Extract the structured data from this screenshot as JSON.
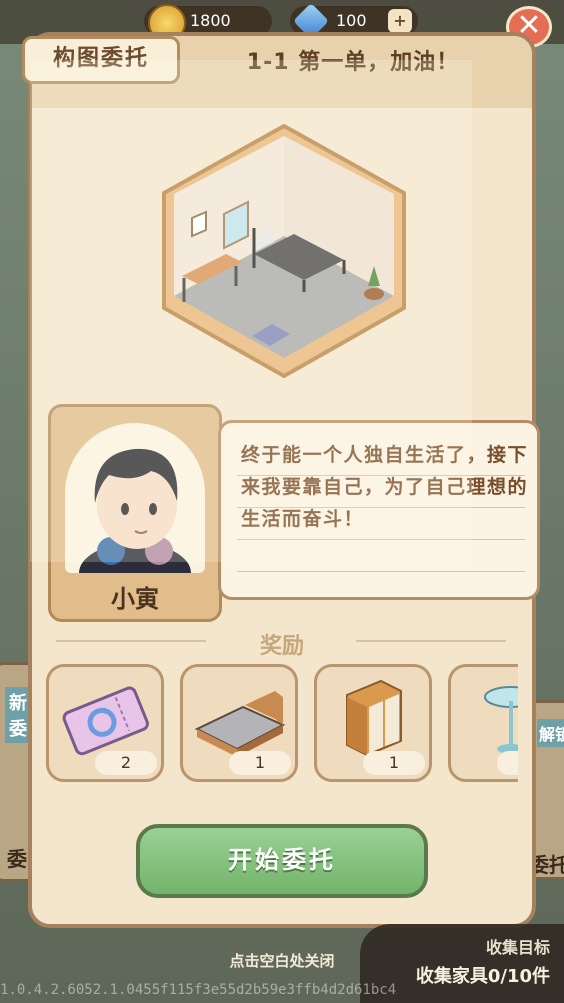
{
  "top_bar": {
    "coins": "1800",
    "gems": "100",
    "coin_icon": "coin-icon",
    "gem_icon": "gem-icon",
    "add_icon": "plus-icon",
    "close_icon": "close-icon"
  },
  "dialog": {
    "tag_label": "构图委托",
    "stage_title": "1-1 第一单，加油！",
    "character_name": "小寅",
    "dialogue": "终于能一个人独自生活了，接下来我要靠自己，为了自己理想的生活而奋斗！",
    "rewards_label": "奖励",
    "rewards": [
      {
        "icon": "ticket-icon",
        "count": "2"
      },
      {
        "icon": "bed-icon",
        "count": "1"
      },
      {
        "icon": "cabinet-icon",
        "count": "1"
      },
      {
        "icon": "table-icon",
        "count": ""
      }
    ],
    "start_button": "开始委托"
  },
  "background": {
    "left_tag": "新委",
    "left_bottom": "委",
    "right_tag": "解锁",
    "right_bottom": "委托"
  },
  "bottom": {
    "close_hint": "点击空白处关闭",
    "collect_title": "收集目标",
    "collect_count": "收集家具0/10件",
    "version": "1.0.4.2.6052.1.0455f115f3e55d2b59e3ffb4d2d61bc4"
  },
  "colors": {
    "panel": "#f4e6cd",
    "border": "#a5825d",
    "accent_green": "#72b46b",
    "text_brown": "#5e3f24"
  }
}
